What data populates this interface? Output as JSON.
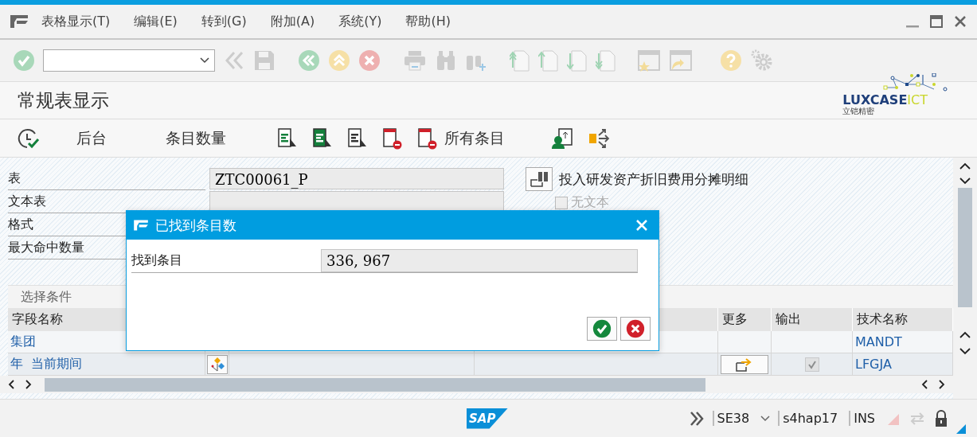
{
  "menu_bar": {
    "items": [
      "表格显示(T)",
      "编辑(E)",
      "转到(G)",
      "附加(A)",
      "系统(Y)",
      "帮助(H)"
    ]
  },
  "screen": {
    "title": "常规表显示",
    "logo": {
      "brand": "LUXCASE",
      "suffix": "ICT",
      "tagline": "立铠精密"
    }
  },
  "app_toolbar": {
    "buttons": [
      {
        "label": "后台"
      },
      {
        "label": "条目数量"
      },
      {
        "label": "所有条目"
      }
    ]
  },
  "form": {
    "fields": [
      {
        "label": "表",
        "value": "ZTC00061_P"
      },
      {
        "label": "文本表"
      },
      {
        "label": "格式"
      },
      {
        "label": "最大命中数量"
      }
    ],
    "table_description": "投入研发资产折旧费用分摊明细",
    "no_text": {
      "label": "无文本",
      "checked": false
    }
  },
  "selection": {
    "tab": "选择条件",
    "columns": {
      "field_name": "字段名称",
      "more": "更多",
      "output": "输出",
      "technical_name": "技术名称"
    },
    "rows": [
      {
        "field_name": "集团",
        "technical_name": "MANDT",
        "value_help": false,
        "more_button": false
      },
      {
        "field_name": "年  当前期间",
        "technical_name": "LFGJA",
        "value_help": true,
        "more_button": true,
        "output": {
          "checked": true,
          "disabled": true
        }
      }
    ]
  },
  "dialog": {
    "title": "已找到条目数",
    "label": "找到条目",
    "value": "336, 967"
  },
  "status_bar": {
    "logo": "SAP",
    "transaction": "SE38",
    "system": "s4hap17",
    "mode": "INS"
  }
}
